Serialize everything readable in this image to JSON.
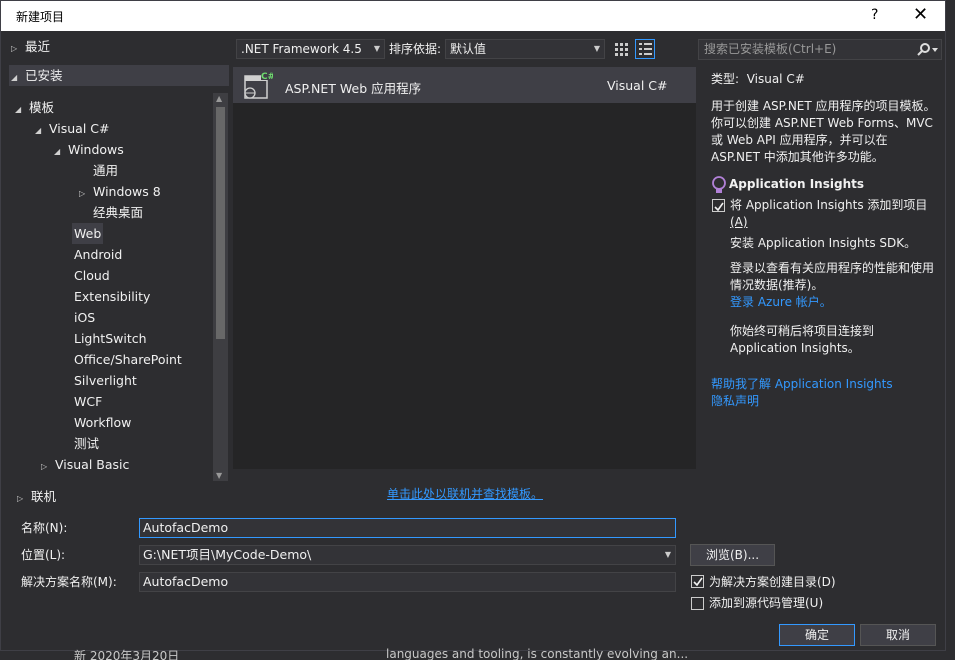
{
  "dialog": {
    "title": "新建项目",
    "help_label": "?",
    "close_label": "✕"
  },
  "tree": {
    "recent": "最近",
    "installed": "已安装",
    "templates": "模板",
    "visual_csharp": "Visual C#",
    "windows": "Windows",
    "general": "通用",
    "windows8": "Windows 8",
    "classic_desktop": "经典桌面",
    "web": "Web",
    "android": "Android",
    "cloud": "Cloud",
    "extensibility": "Extensibility",
    "ios": "iOS",
    "lightswitch": "LightSwitch",
    "office": "Office/SharePoint",
    "silverlight": "Silverlight",
    "wcf": "WCF",
    "workflow": "Workflow",
    "test": "测试",
    "visual_basic": "Visual Basic",
    "online": "联机"
  },
  "toolbar": {
    "framework": ".NET Framework 4.5",
    "sort_label": "排序依据:",
    "sort_value": "默认值"
  },
  "search": {
    "placeholder": "搜索已安装模板(Ctrl+E)"
  },
  "templates": [
    {
      "name": "ASP.NET Web 应用程序",
      "lang": "Visual C#"
    }
  ],
  "online_link": "单击此处以联机并查找模板。",
  "details": {
    "type_label": "类型:",
    "type_value": "Visual C#",
    "desc_1": "用于创建 ASP.NET 应用程序的项目模板。",
    "desc_2": "你可以创建 ASP.NET Web Forms、MVC",
    "desc_3": "或 Web API 应用程序，并可以在",
    "desc_4": "ASP.NET 中添加其他许多功能。",
    "ai_title": "Application Insights",
    "ai_add_1": "将 Application Insights 添加到项目",
    "ai_add_2": "(A)",
    "ai_install": "安装 Application Insights SDK。",
    "ai_login_1": "登录以查看有关应用程序的性能和使用",
    "ai_login_2": "情况数据(推荐)。",
    "ai_login_link": "登录 Azure 帐户。",
    "ai_later_1": "你始终可稍后将项目连接到",
    "ai_later_2": "Application Insights。",
    "help_link": "帮助我了解 Application Insights",
    "privacy_link": "隐私声明"
  },
  "form": {
    "name_label": "名称(N):",
    "name_value": "AutofacDemo",
    "location_label": "位置(L):",
    "location_value": "G:\\NET项目\\MyCode-Demo\\",
    "solution_label": "解决方案名称(M):",
    "solution_value": "AutofacDemo",
    "browse_label": "浏览(B)...",
    "create_dir_label": "为解决方案创建目录(D)",
    "add_source_label": "添加到源代码管理(U)",
    "ok_label": "确定",
    "cancel_label": "取消"
  },
  "background": {
    "date_text": "新 2020年3月20日",
    "article_text": "languages and tooling, is constantly evolving an..."
  }
}
